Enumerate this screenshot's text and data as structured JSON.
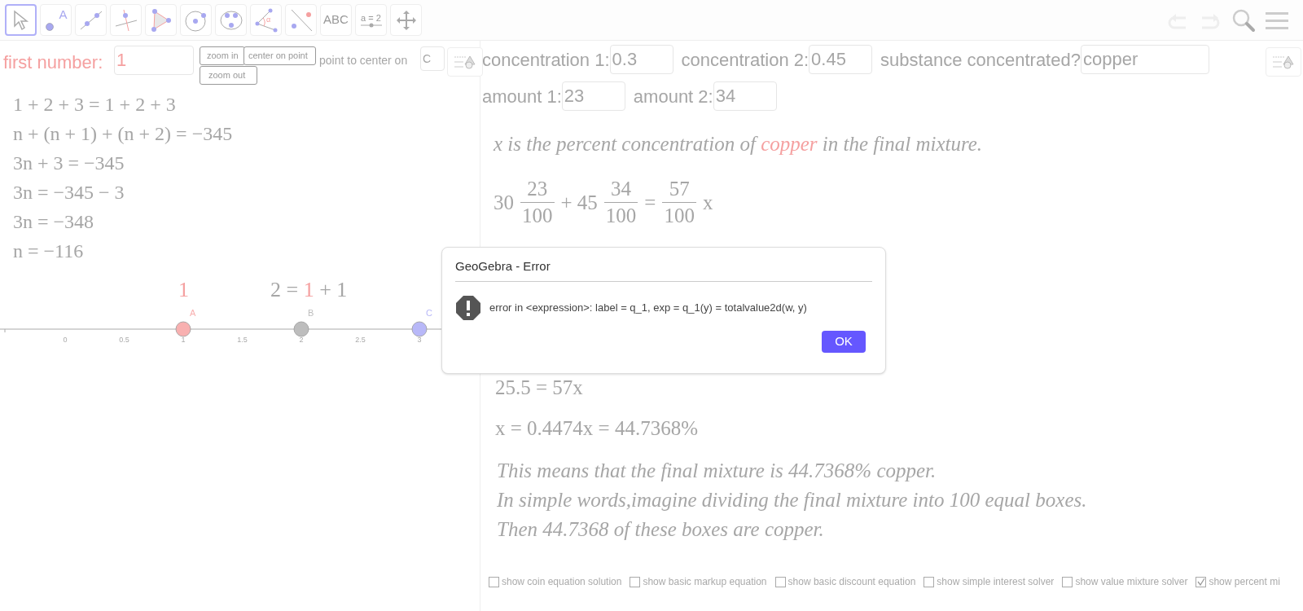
{
  "toolbar": {
    "tools": [
      {
        "kind": "move",
        "selected": true
      },
      {
        "kind": "point",
        "label": "A",
        "selected": false
      },
      {
        "kind": "line",
        "selected": false
      },
      {
        "kind": "perpendicular",
        "selected": false
      },
      {
        "kind": "polygon",
        "selected": false
      },
      {
        "kind": "circle",
        "selected": false
      },
      {
        "kind": "conic",
        "selected": false
      },
      {
        "kind": "angle",
        "label": "α",
        "selected": false
      },
      {
        "kind": "reflect",
        "selected": false
      },
      {
        "kind": "text",
        "label": "ABC",
        "selected": false
      },
      {
        "kind": "slider",
        "label": "a = 2",
        "selected": false
      },
      {
        "kind": "pan",
        "selected": false
      }
    ]
  },
  "left_view": {
    "input": {
      "label": "first number:",
      "value": "1"
    },
    "buttons": [
      {
        "label": "zoom in"
      },
      {
        "label": "center on point"
      },
      {
        "label": "zoom out"
      }
    ],
    "center_input": {
      "label": "point to center on",
      "value": "C"
    },
    "equations": [
      "1 + 2 + 3 = 1 + 2 + 3",
      "n + (n + 1) + (n + 2) = −345",
      "3n + 3 = −345",
      "3n = −345 − 3",
      "3n = −348",
      "n = −116"
    ],
    "value_label": {
      "text": "1",
      "color": "#f5a0a0"
    },
    "sum_label": [
      {
        "text": "2 = ",
        "color": "#a6a6a6"
      },
      {
        "text": "1",
        "color": "#f5a0a0"
      },
      {
        "text": " + 1",
        "color": "#a6a6a6"
      }
    ],
    "number_line": {
      "ticks": [
        {
          "label": "0"
        },
        {
          "label": "0.5"
        },
        {
          "label": "1",
          "point": {
            "label": "A",
            "color": "#f8b0b0"
          }
        },
        {
          "label": "1.5"
        },
        {
          "label": "2",
          "point": {
            "label": "B",
            "color": "#bdbdbd"
          }
        },
        {
          "label": "2.5"
        },
        {
          "label": "3",
          "point": {
            "label": "C",
            "color": "#b8b8f8"
          }
        }
      ]
    }
  },
  "right_view": {
    "input_rows": [
      [
        {
          "label": "concentration 1:",
          "value": "0.3"
        },
        {
          "label": "concentration 2:",
          "value": "0.45"
        },
        {
          "label": "substance concentrated?",
          "value": "copper"
        }
      ],
      [
        {
          "label": "amount 1:",
          "value": "23"
        },
        {
          "label": "amount 2:",
          "value": "34"
        }
      ]
    ],
    "statement": [
      {
        "text": "x is the percent concentration of ",
        "color": "#a6a6a6"
      },
      {
        "text": "copper",
        "color": "#f5a0a0"
      },
      {
        "text": " in the final mixture.",
        "color": "#a6a6a6"
      }
    ],
    "fraction_equation": [
      {
        "kind": "text",
        "text": "30"
      },
      {
        "kind": "frac",
        "num": "23",
        "den": "100"
      },
      {
        "kind": "text",
        "text": "+ 45"
      },
      {
        "kind": "frac",
        "num": "34",
        "den": "100"
      },
      {
        "kind": "text",
        "text": "="
      },
      {
        "kind": "frac",
        "num": "57",
        "den": "100"
      },
      {
        "kind": "text",
        "text": "x"
      }
    ],
    "equations": [
      "25.5 = 57x",
      "x = 0.4474x = 44.7368%"
    ],
    "conclusion": [
      "This means that the final mixture is 44.7368% copper.",
      "In simple words,imagine dividing the final mixture into 100 equal boxes.",
      "Then 44.7368 of these boxes are copper."
    ],
    "checkboxes": [
      {
        "label": "show coin equation solution",
        "checked": false
      },
      {
        "label": "show basic markup equation",
        "checked": false
      },
      {
        "label": "show basic discount equation",
        "checked": false
      },
      {
        "label": "show simple interest solver",
        "checked": false
      },
      {
        "label": "show value mixture solver",
        "checked": false
      },
      {
        "label": "show percent mi",
        "checked": true
      }
    ]
  },
  "dialog": {
    "title": "GeoGebra - Error",
    "message": "error in <expression>: label = q_1, exp = q_1(y) = totalvalue2d(w, y)",
    "button": "OK"
  }
}
